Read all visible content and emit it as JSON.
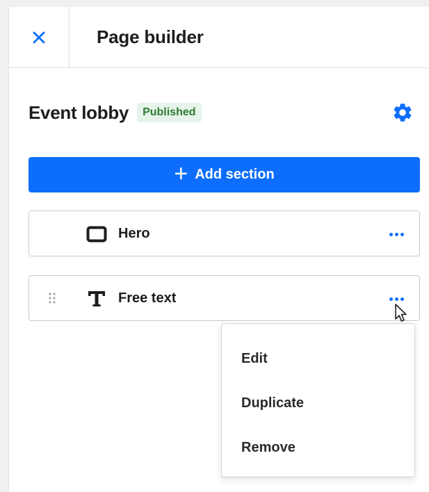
{
  "header": {
    "title": "Page builder",
    "close_icon": "close-icon"
  },
  "page": {
    "name": "Event lobby",
    "status": "Published",
    "settings_icon": "gear-icon"
  },
  "add_section": {
    "label": "Add section",
    "icon": "plus-icon"
  },
  "sections": [
    {
      "label": "Hero",
      "icon": "rectangle-icon"
    },
    {
      "label": "Free text",
      "icon": "text-icon"
    }
  ],
  "context_menu": {
    "items": [
      "Edit",
      "Duplicate",
      "Remove"
    ]
  },
  "colors": {
    "accent": "#0d6efd",
    "badge_bg": "#e6f4ea",
    "badge_text": "#2e7d32"
  }
}
